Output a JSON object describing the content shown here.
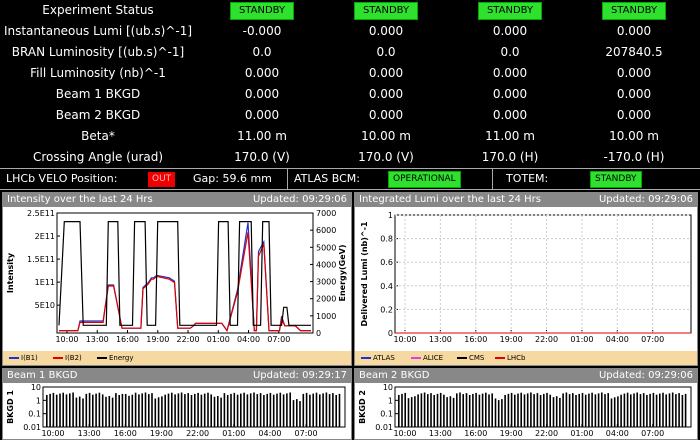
{
  "status_table": {
    "rows": [
      {
        "label": "Experiment Status",
        "badges": [
          "STANDBY",
          "STANDBY",
          "STANDBY",
          "STANDBY"
        ]
      },
      {
        "label": "Instantaneous Lumi [(ub.s)^-1]",
        "values": [
          "-0.000",
          "0.000",
          "0.000",
          "0.000"
        ]
      },
      {
        "label": "BRAN Luminosity [(ub.s)^-1]",
        "values": [
          "0.0",
          "0.0",
          "0.0",
          "207840.5"
        ]
      },
      {
        "label": "Fill Luminosity (nb)^-1",
        "values": [
          "0.000",
          "0.000",
          "0.000",
          "0.000"
        ]
      },
      {
        "label": "Beam 1 BKGD",
        "values": [
          "0.000",
          "0.000",
          "0.000",
          "0.000"
        ]
      },
      {
        "label": "Beam 2 BKGD",
        "values": [
          "0.000",
          "0.000",
          "0.000",
          "0.000"
        ]
      },
      {
        "label": "Beta*",
        "values": [
          "11.00 m",
          "10.00 m",
          "11.00 m",
          "10.00 m"
        ]
      },
      {
        "label": "Crossing Angle (urad)",
        "values": [
          "170.0 (V)",
          "170.0 (V)",
          "170.0 (H)",
          "-170.0 (H)"
        ]
      }
    ]
  },
  "devices": {
    "velo_label": "LHCb VELO Position:",
    "velo_status": "OUT",
    "gap": "Gap: 59.6 mm",
    "bcm_label": "ATLAS BCM:",
    "bcm_status": "OPERATIONAL",
    "totem_label": "TOTEM:",
    "totem_status": "STANDBY"
  },
  "colors": {
    "green": "#2fe02f",
    "red": "#e00000",
    "panel_header": "#888888",
    "legend_bg": "#f5d9a0"
  },
  "panels": {
    "intensity": {
      "title": "Intensity over the last 24 Hrs",
      "updated": "Updated: 09:29:06"
    },
    "lumi": {
      "title": "Integrated Lumi over the last 24 Hrs",
      "updated": "Updated: 09:29:06"
    },
    "beam1": {
      "title": "Beam 1 BKGD",
      "updated": "Updated: 09:29:17"
    },
    "beam2": {
      "title": "Beam 2 BKGD",
      "updated": "Updated: 09:29:06"
    }
  },
  "chart_data": [
    {
      "type": "line",
      "x_ticks": [
        "10:00",
        "13:00",
        "16:00",
        "19:00",
        "22:00",
        "01:00",
        "04:00",
        "07:00"
      ],
      "ylabel": "Intensity",
      "yticks": [
        "2.5E11",
        "2E11",
        "1.5E11",
        "1E11",
        "5E10"
      ],
      "ylim": [
        0,
        250000000000.0
      ],
      "y2label": "Energy(GeV)",
      "y2ticks": [
        "7000",
        "6000",
        "5000",
        "4000",
        "3000",
        "2000",
        "1000",
        "0"
      ],
      "y2lim": [
        0,
        7000
      ],
      "series": [
        {
          "name": "I(B1)",
          "color": "#2030d0",
          "x": [
            0,
            1,
            1.8,
            2.0,
            2.4,
            3.0,
            4.2,
            4.7,
            4.9,
            5.2,
            6.0,
            7.0,
            7.8,
            8.0,
            8.5,
            8.8,
            9.0,
            9.3,
            10.5,
            11.0,
            11.3,
            12.5,
            12.8,
            13.0,
            15.2,
            15.5,
            16.0,
            17.0,
            18.0,
            18.6,
            18.8,
            19.0,
            19.5,
            20.0,
            20.5,
            21.0,
            21.2,
            21.5,
            22.5,
            23.0,
            24.0
          ],
          "y": [
            5000000000.0,
            5000000000.0,
            5000000000.0,
            25000000000.0,
            25000000000.0,
            25000000000.0,
            25000000000.0,
            100000000000.0,
            100000000000.0,
            100000000000.0,
            10000000000.0,
            10000000000.0,
            10000000000.0,
            95000000000.0,
            105000000000.0,
            115000000000.0,
            115000000000.0,
            120000000000.0,
            115000000000.0,
            108000000000.0,
            10000000000.0,
            10000000000.0,
            15000000000.0,
            20000000000.0,
            20000000000.0,
            20000000000.0,
            5000000000.0,
            90000000000.0,
            230000000000.0,
            5000000000.0,
            5000000000.0,
            170000000000.0,
            190000000000.0,
            5000000000.0,
            5000000000.0,
            5000000000.0,
            35000000000.0,
            15000000000.0,
            15000000000.0,
            5000000000.0,
            5000000000.0
          ]
        },
        {
          "name": "I(B2)",
          "color": "#e00000",
          "x": [
            0,
            1,
            1.8,
            2.0,
            2.4,
            3.0,
            4.2,
            4.7,
            4.9,
            5.2,
            6.0,
            7.0,
            7.8,
            8.0,
            8.5,
            8.8,
            9.0,
            9.3,
            10.5,
            11.0,
            11.3,
            12.5,
            12.8,
            13.0,
            15.2,
            15.5,
            16.0,
            17.0,
            18.0,
            18.6,
            18.8,
            19.0,
            19.5,
            20.0,
            20.5,
            21.0,
            21.2,
            21.5,
            22.5,
            23.0,
            24.0
          ],
          "y": [
            5000000000.0,
            5000000000.0,
            5000000000.0,
            22000000000.0,
            22000000000.0,
            22000000000.0,
            22000000000.0,
            98000000000.0,
            98000000000.0,
            98000000000.0,
            10000000000.0,
            10000000000.0,
            10000000000.0,
            92000000000.0,
            102000000000.0,
            112000000000.0,
            112000000000.0,
            118000000000.0,
            112000000000.0,
            105000000000.0,
            10000000000.0,
            10000000000.0,
            15000000000.0,
            20000000000.0,
            20000000000.0,
            20000000000.0,
            5000000000.0,
            85000000000.0,
            210000000000.0,
            5000000000.0,
            5000000000.0,
            160000000000.0,
            185000000000.0,
            5000000000.0,
            5000000000.0,
            5000000000.0,
            30000000000.0,
            15000000000.0,
            15000000000.0,
            5000000000.0,
            5000000000.0
          ]
        },
        {
          "name": "Energy",
          "color": "#000000",
          "axis": "right",
          "x": [
            0,
            0.5,
            1.0,
            2.0,
            2.3,
            2.8,
            3.0,
            4.5,
            4.7,
            5.6,
            5.8,
            7.0,
            7.2,
            8.2,
            8.4,
            9.2,
            9.4,
            11.3,
            11.5,
            15.0,
            15.2,
            16.1,
            16.3,
            17.0,
            17.2,
            18.3,
            18.5,
            19.2,
            19.4,
            20.0,
            20.2,
            21.2,
            21.4,
            21.7,
            21.9,
            23.0,
            24.0
          ],
          "y": [
            450,
            6500,
            6500,
            6500,
            450,
            450,
            450,
            450,
            6500,
            6500,
            450,
            450,
            6500,
            6500,
            450,
            450,
            6500,
            6500,
            450,
            450,
            6500,
            6500,
            450,
            450,
            6500,
            6500,
            450,
            450,
            6500,
            6500,
            450,
            450,
            1500,
            1500,
            450,
            450,
            450
          ]
        }
      ],
      "legend": "bottom"
    },
    {
      "type": "line",
      "x_ticks": [
        "10:00",
        "13:00",
        "16:00",
        "19:00",
        "22:00",
        "01:00",
        "04:00",
        "07:00"
      ],
      "ylabel": "Delivered Lumi (nb)^-1",
      "yticks": [
        "1",
        "0.8",
        "0.6",
        "0.4",
        "0.2",
        "0"
      ],
      "ylim": [
        0,
        1
      ],
      "grid": true,
      "series": [
        {
          "name": "ATLAS",
          "color": "#2030d0",
          "x": [
            0,
            24
          ],
          "y": [
            0,
            0
          ]
        },
        {
          "name": "ALICE",
          "color": "#e040e0",
          "x": [
            0,
            24
          ],
          "y": [
            0,
            0
          ]
        },
        {
          "name": "CMS",
          "color": "#000000",
          "x": [
            0,
            24
          ],
          "y": [
            0,
            0
          ]
        },
        {
          "name": "LHCb",
          "color": "#e00000",
          "x": [
            0,
            24
          ],
          "y": [
            0,
            0
          ]
        }
      ],
      "legend": "bottom"
    },
    {
      "type": "bar",
      "ylabel": "BKGD 1",
      "yticks": [
        "10",
        "1",
        "0.1",
        "0.01"
      ],
      "ylim": [
        0.01,
        30
      ],
      "log": true,
      "x_ticks": [
        "10:00",
        "13:00",
        "16:00",
        "19:00",
        "22:00",
        "01:00",
        "04:00",
        "07:00"
      ],
      "values_profile": [
        10,
        10,
        10,
        5,
        10,
        10,
        5,
        10,
        8,
        10,
        10,
        5,
        10,
        10,
        10,
        10,
        10,
        5,
        10,
        10,
        10,
        10,
        10,
        10,
        10,
        3,
        10,
        10,
        10,
        10
      ]
    },
    {
      "type": "bar",
      "ylabel": "BKGD 2",
      "yticks": [
        "10",
        "1",
        "0.1",
        "0.01"
      ],
      "ylim": [
        0.01,
        30
      ],
      "log": true,
      "x_ticks": [
        "10:00",
        "13:00",
        "16:00",
        "19:00",
        "22:00",
        "01:00",
        "04:00",
        "07:00"
      ],
      "values_profile": [
        10,
        5,
        10,
        10,
        10,
        5,
        10,
        10,
        10,
        10,
        3,
        10,
        10,
        10,
        10,
        10,
        5,
        10,
        10,
        10,
        10,
        10,
        5,
        10,
        10,
        10,
        10,
        10,
        10,
        10
      ]
    }
  ]
}
